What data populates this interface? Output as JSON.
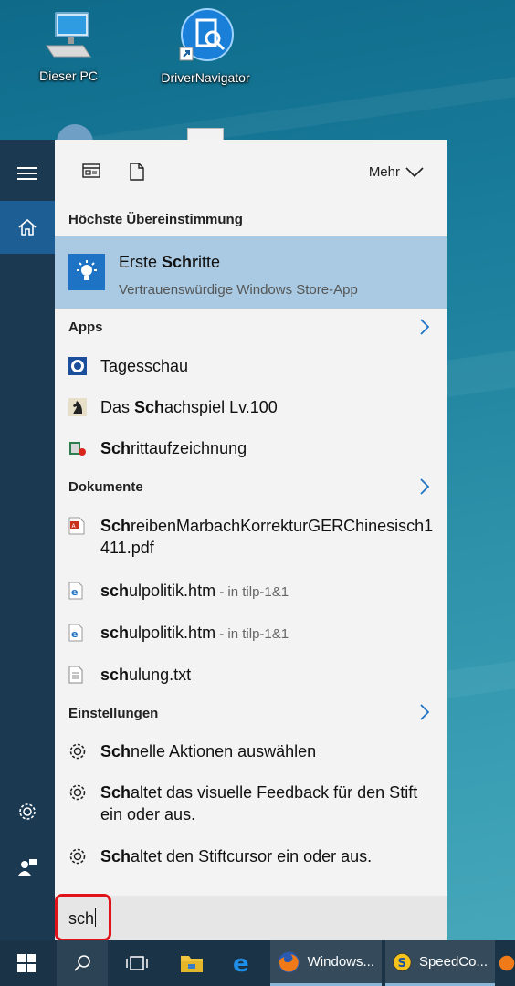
{
  "desktop": {
    "icons": [
      {
        "label": "Dieser PC",
        "icon": "computer-icon"
      },
      {
        "label": "DriverNavigator",
        "icon": "driver-navigator-icon"
      }
    ]
  },
  "rail": {
    "items": [
      "hamburger-icon",
      "home-icon",
      "settings-icon",
      "feedback-icon"
    ]
  },
  "toolbar": {
    "more_label": "Mehr"
  },
  "best_match": {
    "heading": "Höchste Übereinstimmung",
    "title_plain": "Erste ",
    "title_bold": "Schr",
    "title_rest": "itte",
    "subtitle": "Vertrauenswürdige Windows Store-App"
  },
  "apps": {
    "heading": "Apps",
    "items": [
      {
        "bold": "",
        "rest": "Tagesschau"
      },
      {
        "plain": "Das ",
        "bold": "Sch",
        "rest": "achspiel Lv.100"
      },
      {
        "bold": "Sch",
        "rest": "rittaufzeichnung"
      }
    ]
  },
  "documents": {
    "heading": "Dokumente",
    "items": [
      {
        "bold": "Sch",
        "rest": "reibenMarbachKorrekturGERChinesisch1",
        "rest2": "411.pdf",
        "location": ""
      },
      {
        "bold": "sch",
        "rest": "ulpolitik.htm",
        "location": " - in tilp-1&1"
      },
      {
        "bold": "sch",
        "rest": "ulpolitik.htm",
        "location": " - in tilp-1&1"
      },
      {
        "bold": "sch",
        "rest": "ulung.txt",
        "location": ""
      }
    ]
  },
  "settings": {
    "heading": "Einstellungen",
    "items": [
      {
        "bold": "Sch",
        "rest": "nelle Aktionen auswählen",
        "rest2": ""
      },
      {
        "bold": "Sch",
        "rest": "altet das visuelle Feedback für den Stift",
        "rest2": "ein oder aus."
      },
      {
        "bold": "Sch",
        "rest": "altet den Stiftcursor ein oder aus.",
        "rest2": ""
      }
    ]
  },
  "search": {
    "value": "sch"
  },
  "taskbar": {
    "apps": [
      {
        "label": "Windows..."
      },
      {
        "label": "SpeedCo..."
      }
    ]
  },
  "colors": {
    "accent": "#1e73c4",
    "highlight": "#a9cae2",
    "rail": "#1b3a52",
    "taskbar": "#1a3346",
    "outline": "#e0131a"
  }
}
